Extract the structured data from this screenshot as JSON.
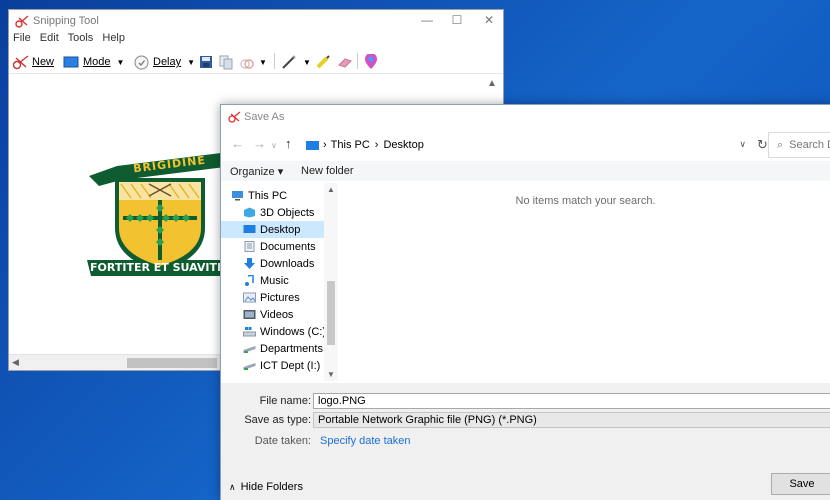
{
  "snipping_tool": {
    "title": "Snipping Tool",
    "menu": [
      "File",
      "Edit",
      "Tools",
      "Help"
    ],
    "toolbar": {
      "new_label": "New",
      "mode_label": "Mode",
      "delay_label": "Delay"
    },
    "logo": {
      "top_banner": "BRIGIDINE",
      "bottom_banner": "FORTITER ET SUAVITER",
      "colors": {
        "green": "#0e5c2f",
        "gold": "#f2c230"
      }
    }
  },
  "save_as": {
    "title": "Save As",
    "breadcrumb": [
      "This PC",
      "Desktop"
    ],
    "search_placeholder": "Search Desktop",
    "commands": {
      "organize": "Organize ▾",
      "new_folder": "New folder"
    },
    "nav_items": [
      {
        "label": "This PC",
        "icon": "computer-icon",
        "selected": false
      },
      {
        "label": "3D Objects",
        "icon": "3d-objects-icon",
        "selected": false
      },
      {
        "label": "Desktop",
        "icon": "desktop-icon",
        "selected": true
      },
      {
        "label": "Documents",
        "icon": "documents-icon",
        "selected": false
      },
      {
        "label": "Downloads",
        "icon": "downloads-icon",
        "selected": false
      },
      {
        "label": "Music",
        "icon": "music-icon",
        "selected": false
      },
      {
        "label": "Pictures",
        "icon": "pictures-icon",
        "selected": false
      },
      {
        "label": "Videos",
        "icon": "videos-icon",
        "selected": false
      },
      {
        "label": "Windows (C:)",
        "icon": "drive-icon",
        "selected": false
      },
      {
        "label": "Departments (G:",
        "icon": "network-drive-icon",
        "selected": false
      },
      {
        "label": "ICT Dept (I:)",
        "icon": "network-drive-icon",
        "selected": false
      }
    ],
    "empty_message": "No items match your search.",
    "file_name_label": "File name:",
    "file_name_value": "logo.PNG",
    "save_type_label": "Save as type:",
    "save_type_value": "Portable Network Graphic file (PNG) (*.PNG)",
    "date_taken_label": "Date taken:",
    "date_taken_value": "Specify date taken",
    "hide_folders": "Hide Folders",
    "save_button": "Save"
  },
  "colors": {
    "desktop_bg": "#0b4db5",
    "selection": "#cce8ff",
    "link": "#1a6fd6"
  }
}
